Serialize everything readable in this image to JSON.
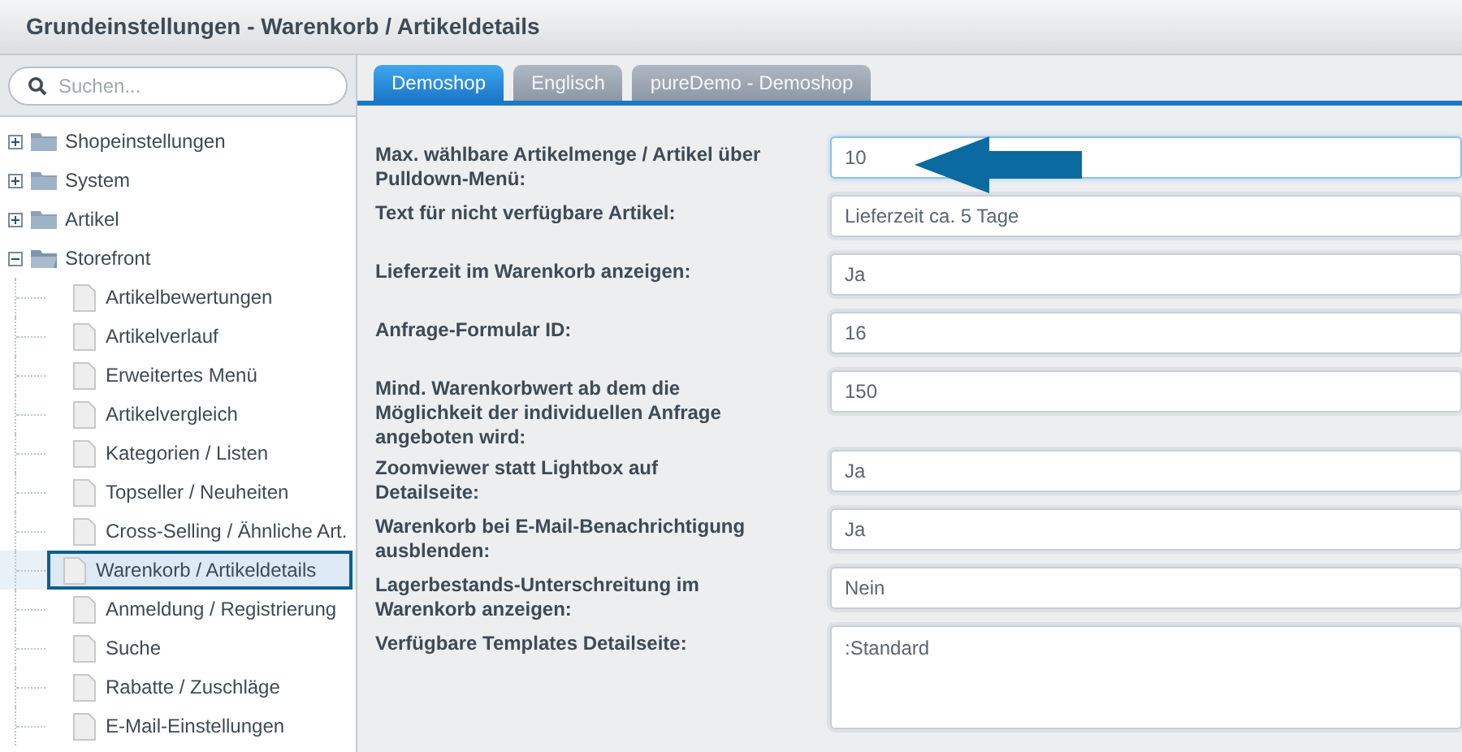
{
  "window": {
    "title": "Grundeinstellungen - Warenkorb / Artikeldetails"
  },
  "sidebar": {
    "search": {
      "placeholder": "Suchen..."
    },
    "tree": [
      {
        "label": "Shopeinstellungen",
        "expanded": false
      },
      {
        "label": "System",
        "expanded": false
      },
      {
        "label": "Artikel",
        "expanded": false
      },
      {
        "label": "Storefront",
        "expanded": true,
        "children": [
          {
            "label": "Artikelbewertungen",
            "selected": false
          },
          {
            "label": "Artikelverlauf",
            "selected": false
          },
          {
            "label": "Erweitertes Menü",
            "selected": false
          },
          {
            "label": "Artikelvergleich",
            "selected": false
          },
          {
            "label": "Kategorien / Listen",
            "selected": false
          },
          {
            "label": "Topseller / Neuheiten",
            "selected": false
          },
          {
            "label": "Cross-Selling / Ähnliche Art.",
            "selected": false
          },
          {
            "label": "Warenkorb / Artikeldetails",
            "selected": true
          },
          {
            "label": "Anmeldung / Registrierung",
            "selected": false
          },
          {
            "label": "Suche",
            "selected": false
          },
          {
            "label": "Rabatte / Zuschläge",
            "selected": false
          },
          {
            "label": "E-Mail-Einstellungen",
            "selected": false
          }
        ]
      }
    ]
  },
  "tabs": [
    {
      "label": "Demoshop",
      "selected": true
    },
    {
      "label": "Englisch",
      "selected": false
    },
    {
      "label": "pureDemo - Demoshop",
      "selected": false
    }
  ],
  "form": [
    {
      "label": "Max. wählbare Artikelmenge / Artikel über Pulldown-Menü:",
      "value": "10",
      "focused": true,
      "kind": "input"
    },
    {
      "label": "Text für nicht verfügbare Artikel:",
      "value": "Lieferzeit ca. 5 Tage",
      "focused": false,
      "kind": "input"
    },
    {
      "label": "Lieferzeit im Warenkorb anzeigen:",
      "value": "Ja",
      "focused": false,
      "kind": "input"
    },
    {
      "label": "Anfrage-Formular ID:",
      "value": "16",
      "focused": false,
      "kind": "input"
    },
    {
      "label": "Mind. Warenkorbwert ab dem die Möglichkeit der individuellen Anfrage angeboten wird:",
      "value": "150",
      "focused": false,
      "kind": "input"
    },
    {
      "label": "Zoomviewer statt Lightbox auf Detailseite:",
      "value": "Ja",
      "focused": false,
      "kind": "input"
    },
    {
      "label": "Warenkorb bei E-Mail-Benachrichtigung ausblenden:",
      "value": "Ja",
      "focused": false,
      "kind": "input"
    },
    {
      "label": "Lagerbestands-Unterschreitung im Warenkorb anzeigen:",
      "value": "Nein",
      "focused": false,
      "kind": "input"
    },
    {
      "label": "Verfügbare Templates Detailseite:",
      "value": ":Standard",
      "focused": false,
      "kind": "textarea"
    }
  ]
}
